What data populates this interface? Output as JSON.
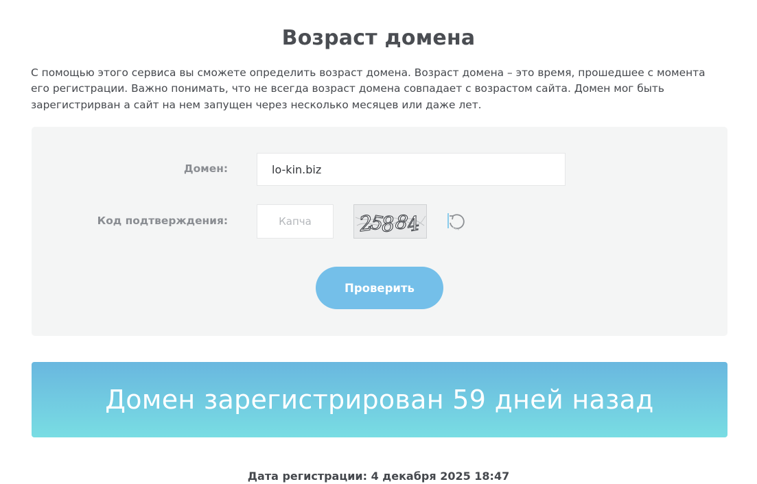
{
  "page": {
    "title": "Возраст домена",
    "description": "С помощью этого сервиса вы сможете определить возраст домена. Возраст домена – это время, прошедшее с момента его регистрации. Важно понимать, что не всегда возраст домена совпадает с возрастом сайта. Домен мог быть зарегистрирван а сайт на нем запущен через несколько месяцев или даже лет."
  },
  "form": {
    "domain_label": "Домен:",
    "domain_value": "lo-kin.biz",
    "captcha_label": "Код подтверждения:",
    "captcha_placeholder": "Капча",
    "captcha_value": "",
    "captcha_image_text": "25884",
    "refresh_icon": "refresh-icon",
    "submit_label": "Проверить"
  },
  "result": {
    "headline": "Домен зарегистрирован 59 дней назад",
    "registration_date": "Дата регистрации: 4 декабря 2025 18:47"
  },
  "colors": {
    "button": "#74bfe9",
    "banner_top": "#69b7df",
    "banner_bottom": "#79dde3",
    "panel": "#f4f5f5",
    "text": "#4a4d52"
  }
}
